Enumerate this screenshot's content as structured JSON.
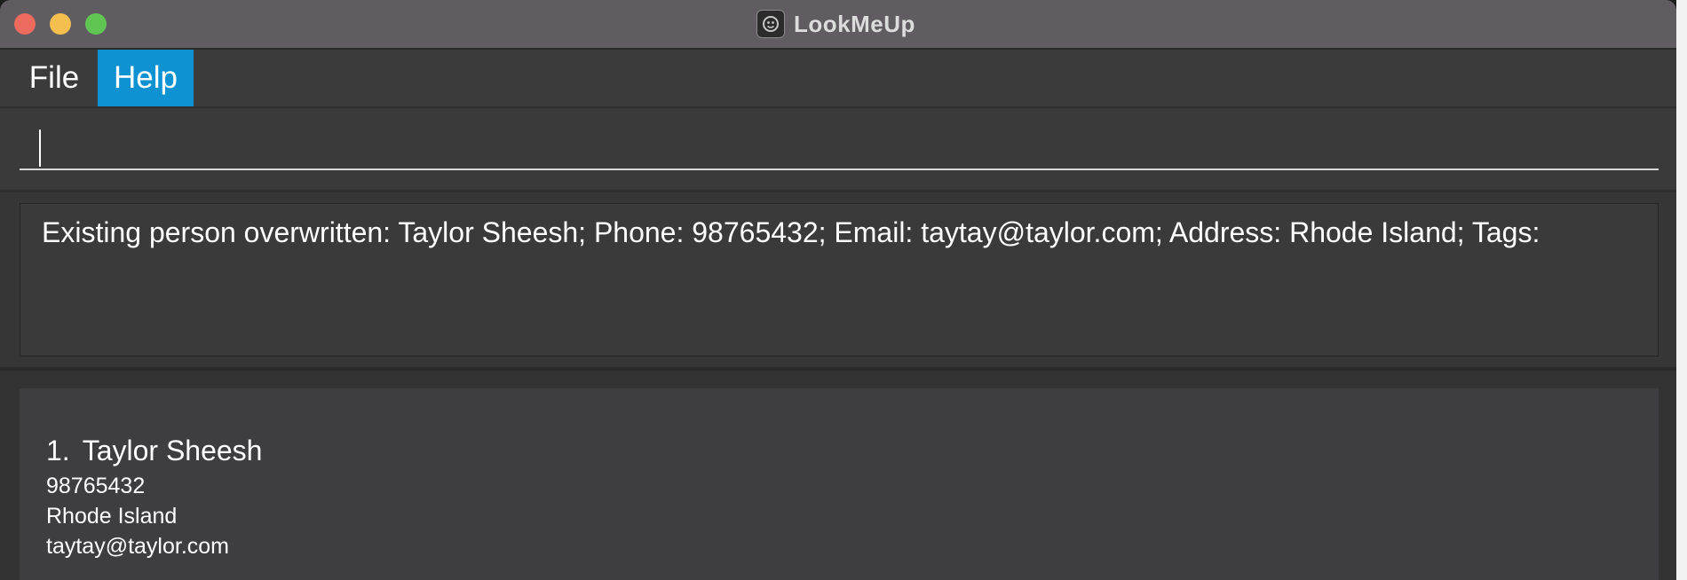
{
  "window": {
    "title": "LookMeUp",
    "app_icon": "lookmeup-app-icon"
  },
  "menu": {
    "items": [
      {
        "label": "File",
        "selected": false
      },
      {
        "label": "Help",
        "selected": true
      }
    ]
  },
  "command_box": {
    "value": "",
    "placeholder": ""
  },
  "result_display": {
    "text": "Existing person overwritten: Taylor Sheesh; Phone: 98765432; Email: taytay@taylor.com; Address: Rhode Island; Tags:"
  },
  "person_list": [
    {
      "index": "1.",
      "name": "Taylor Sheesh",
      "phone": "98765432",
      "address": "Rhode Island",
      "email": "taytay@taylor.com"
    }
  ],
  "colors": {
    "titlebar": "#605c61",
    "window_bg": "#3a3a3a",
    "menu_highlight": "#0f92d2",
    "close_button": "#ec6a5e",
    "minimize_button": "#f4bf4f",
    "maximize_button": "#61c554"
  }
}
